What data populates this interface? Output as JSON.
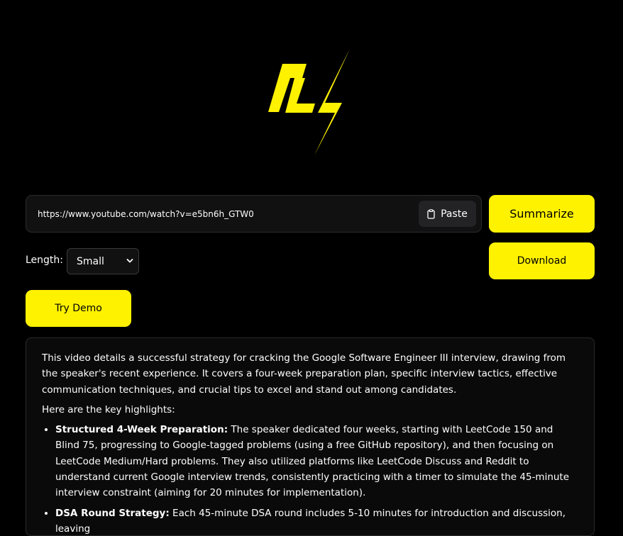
{
  "brand": {
    "logo_icon": "lightning-c-logo",
    "accent_color": "#fff200"
  },
  "url_input": {
    "value": "https://www.youtube.com/watch?v=e5bn6h_GTW0"
  },
  "paste_button": {
    "label": "Paste",
    "icon": "clipboard-icon"
  },
  "summarize_button": {
    "label": "Summarize"
  },
  "download_button": {
    "label": "Download"
  },
  "demo_button": {
    "label": "Try Demo"
  },
  "length": {
    "label": "Length:",
    "selected": "Small",
    "icon": "chevron-down-icon"
  },
  "summary": {
    "intro": "This video details a successful strategy for cracking the Google Software Engineer III interview, drawing from the speaker's recent experience. It covers a four-week preparation plan, specific interview tactics, effective communication techniques, and crucial tips to excel and stand out among candidates.",
    "highlights_heading": "Here are the key highlights:",
    "highlights": [
      {
        "title": "Structured 4-Week Preparation:",
        "text": " The speaker dedicated four weeks, starting with LeetCode 150 and Blind 75, progressing to Google-tagged problems (using a free GitHub repository), and then focusing on LeetCode Medium/Hard problems. They also utilized platforms like LeetCode Discuss and Reddit to understand current Google interview trends, consistently practicing with a timer to simulate the 45-minute interview constraint (aiming for 20 minutes for implementation)."
      },
      {
        "title": "DSA Round Strategy:",
        "text": " Each 45-minute DSA round includes 5-10 minutes for introduction and discussion, leaving"
      }
    ]
  }
}
